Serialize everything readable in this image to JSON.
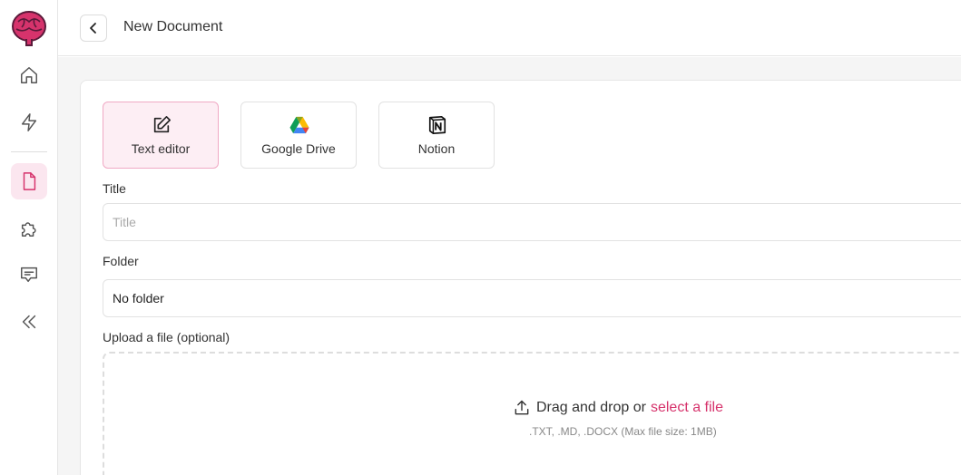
{
  "header": {
    "title": "New Document"
  },
  "sidebar": {
    "items": [
      {
        "icon": "home-icon"
      },
      {
        "icon": "lightning-icon"
      },
      {
        "icon": "document-icon",
        "active": true
      },
      {
        "icon": "puzzle-icon"
      },
      {
        "icon": "chat-icon"
      },
      {
        "icon": "collapse-icon"
      }
    ]
  },
  "sources": [
    {
      "label": "Text editor",
      "icon": "edit-icon",
      "selected": true
    },
    {
      "label": "Google Drive",
      "icon": "google-drive-icon",
      "selected": false
    },
    {
      "label": "Notion",
      "icon": "notion-icon",
      "selected": false
    }
  ],
  "form": {
    "title_label": "Title",
    "title_placeholder": "Title",
    "title_value": "",
    "folder_label": "Folder",
    "folder_value": "No folder",
    "upload_label": "Upload a file (optional)"
  },
  "dropzone": {
    "text": "Drag and drop or",
    "link": "select a file",
    "hint": ".TXT, .MD, .DOCX (Max file size: 1MB)"
  },
  "colors": {
    "accent": "#d6336c",
    "accent_bg": "#fdeef4"
  }
}
